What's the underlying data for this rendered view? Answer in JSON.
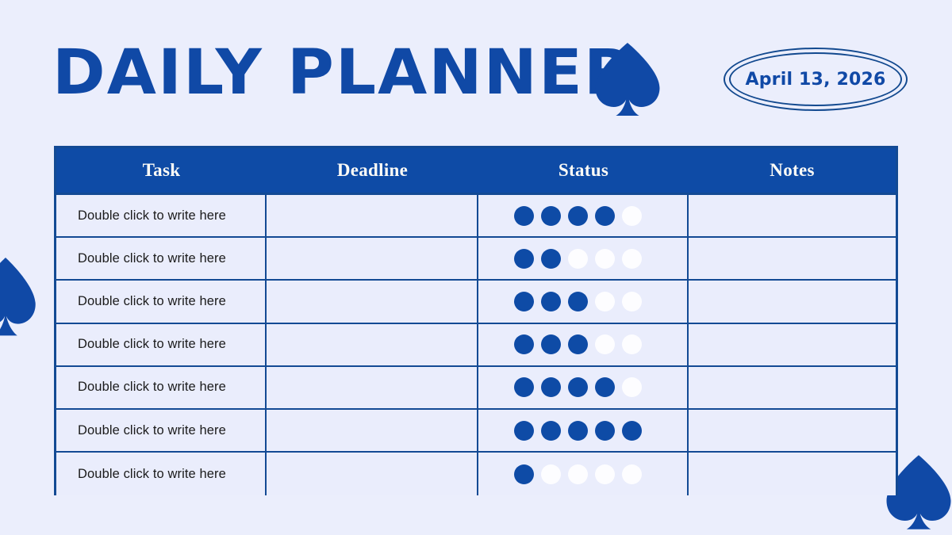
{
  "header": {
    "title": "DAILY PLANNER",
    "spade_icon": "spade-icon",
    "date": "April 13, 2026"
  },
  "decorations": {
    "left_spade_icon": "spade-icon",
    "bottom_right_spade_icon": "spade-icon"
  },
  "colors": {
    "page_background": "#ebeefc",
    "accent_blue": "#0e4ba6",
    "title_blue": "#1049a6",
    "border_blue": "#134a94",
    "cell_background": "#eaedfc",
    "header_text": "#fdfcf7",
    "dot_filled": "#0e4ba6",
    "dot_empty": "#fdfdff"
  },
  "table": {
    "columns": [
      "Task",
      "Deadline",
      "Status",
      "Notes"
    ],
    "status_total_dots": 5,
    "rows": [
      {
        "task": "Double click to write here",
        "deadline": "",
        "status_filled": 4,
        "notes": ""
      },
      {
        "task": "Double click to write here",
        "deadline": "",
        "status_filled": 2,
        "notes": ""
      },
      {
        "task": "Double click to write here",
        "deadline": "",
        "status_filled": 3,
        "notes": ""
      },
      {
        "task": "Double click to write here",
        "deadline": "",
        "status_filled": 3,
        "notes": ""
      },
      {
        "task": "Double click to write here",
        "deadline": "",
        "status_filled": 4,
        "notes": ""
      },
      {
        "task": "Double click to write here",
        "deadline": "",
        "status_filled": 5,
        "notes": ""
      },
      {
        "task": "Double click to write here",
        "deadline": "",
        "status_filled": 1,
        "notes": ""
      }
    ]
  }
}
